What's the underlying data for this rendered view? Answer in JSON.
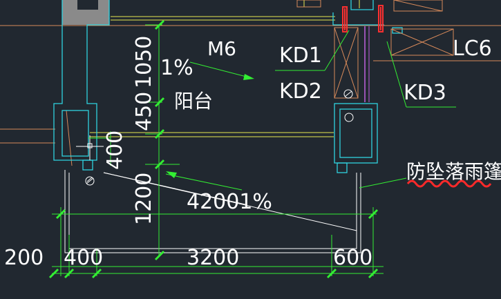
{
  "labels": {
    "m6": "M6",
    "kd1": "KD1",
    "kd2": "KD2",
    "kd3": "KD3",
    "lc6": "LC6",
    "slope_top": "1%",
    "balcony": "阳台",
    "dim_1050": "1050",
    "dim_450": "450",
    "dim_400v": "400",
    "dim_1200": "1200",
    "slope_label": "42001%",
    "canopy": "防坠落雨篷",
    "dim_200": "200",
    "dim_400h": "400",
    "dim_3200": "3200",
    "dim_600": "600"
  },
  "colors": {
    "background": "#212830",
    "wall_cyan": "#2fd3e0",
    "dim_green": "#33ee33",
    "text": "#ffffff",
    "wavy_red": "#ff2a2a",
    "yellow": "#e8e850",
    "orange": "#d88a5a",
    "magenta": "#c060e0",
    "red": "#ff3030"
  }
}
